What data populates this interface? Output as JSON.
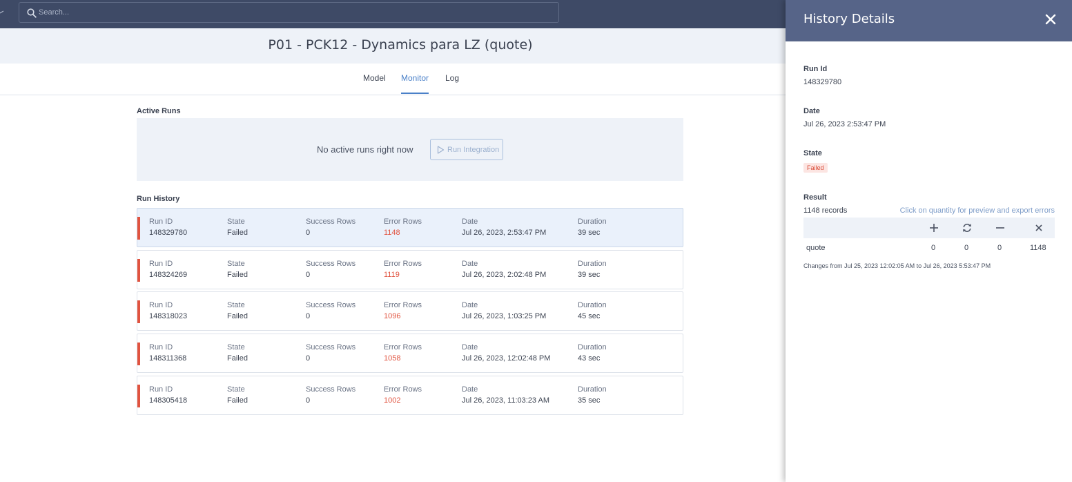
{
  "search": {
    "placeholder": "Search..."
  },
  "page": {
    "title": "P01 - PCK12 - Dynamics para LZ (quote)"
  },
  "tabs": [
    {
      "label": "Model"
    },
    {
      "label": "Monitor"
    },
    {
      "label": "Log"
    }
  ],
  "active_runs": {
    "heading": "Active Runs",
    "empty_text": "No active runs right now",
    "run_button": "Run Integration"
  },
  "history": {
    "heading": "Run History",
    "columns": {
      "run_id": "Run ID",
      "state": "State",
      "success": "Success Rows",
      "error": "Error Rows",
      "date": "Date",
      "duration": "Duration"
    },
    "rows": [
      {
        "run_id": "148329780",
        "state": "Failed",
        "success": "0",
        "error": "1148",
        "date": "Jul 26, 2023, 2:53:47 PM",
        "duration": "39 sec"
      },
      {
        "run_id": "148324269",
        "state": "Failed",
        "success": "0",
        "error": "1119",
        "date": "Jul 26, 2023, 2:02:48 PM",
        "duration": "39 sec"
      },
      {
        "run_id": "148318023",
        "state": "Failed",
        "success": "0",
        "error": "1096",
        "date": "Jul 26, 2023, 1:03:25 PM",
        "duration": "45 sec"
      },
      {
        "run_id": "148311368",
        "state": "Failed",
        "success": "0",
        "error": "1058",
        "date": "Jul 26, 2023, 12:02:48 PM",
        "duration": "43 sec"
      },
      {
        "run_id": "148305418",
        "state": "Failed",
        "success": "0",
        "error": "1002",
        "date": "Jul 26, 2023, 11:03:23 AM",
        "duration": "35 sec"
      }
    ]
  },
  "panel": {
    "title": "History Details",
    "run_id_label": "Run Id",
    "run_id": "148329780",
    "date_label": "Date",
    "date": "Jul 26, 2023 2:53:47 PM",
    "state_label": "State",
    "state": "Failed",
    "result_label": "Result",
    "records": "1148 records",
    "hint": "Click on quantity for preview and export errors",
    "result_row": {
      "object": "quote",
      "inserted": "0",
      "updated": "0",
      "deleted": "0",
      "failed": "1148"
    },
    "changes": "Changes from Jul 25, 2023 12:02:05 AM to Jul 26, 2023 5:53:47 PM"
  },
  "colors": {
    "topbar": "#3e4a66",
    "panel_header": "#566488",
    "accent": "#4a80c8",
    "error": "#e1533f"
  },
  "icons": [
    "search-icon",
    "play-icon",
    "close-icon",
    "plus-icon",
    "sync-icon",
    "minus-icon",
    "x-icon"
  ]
}
